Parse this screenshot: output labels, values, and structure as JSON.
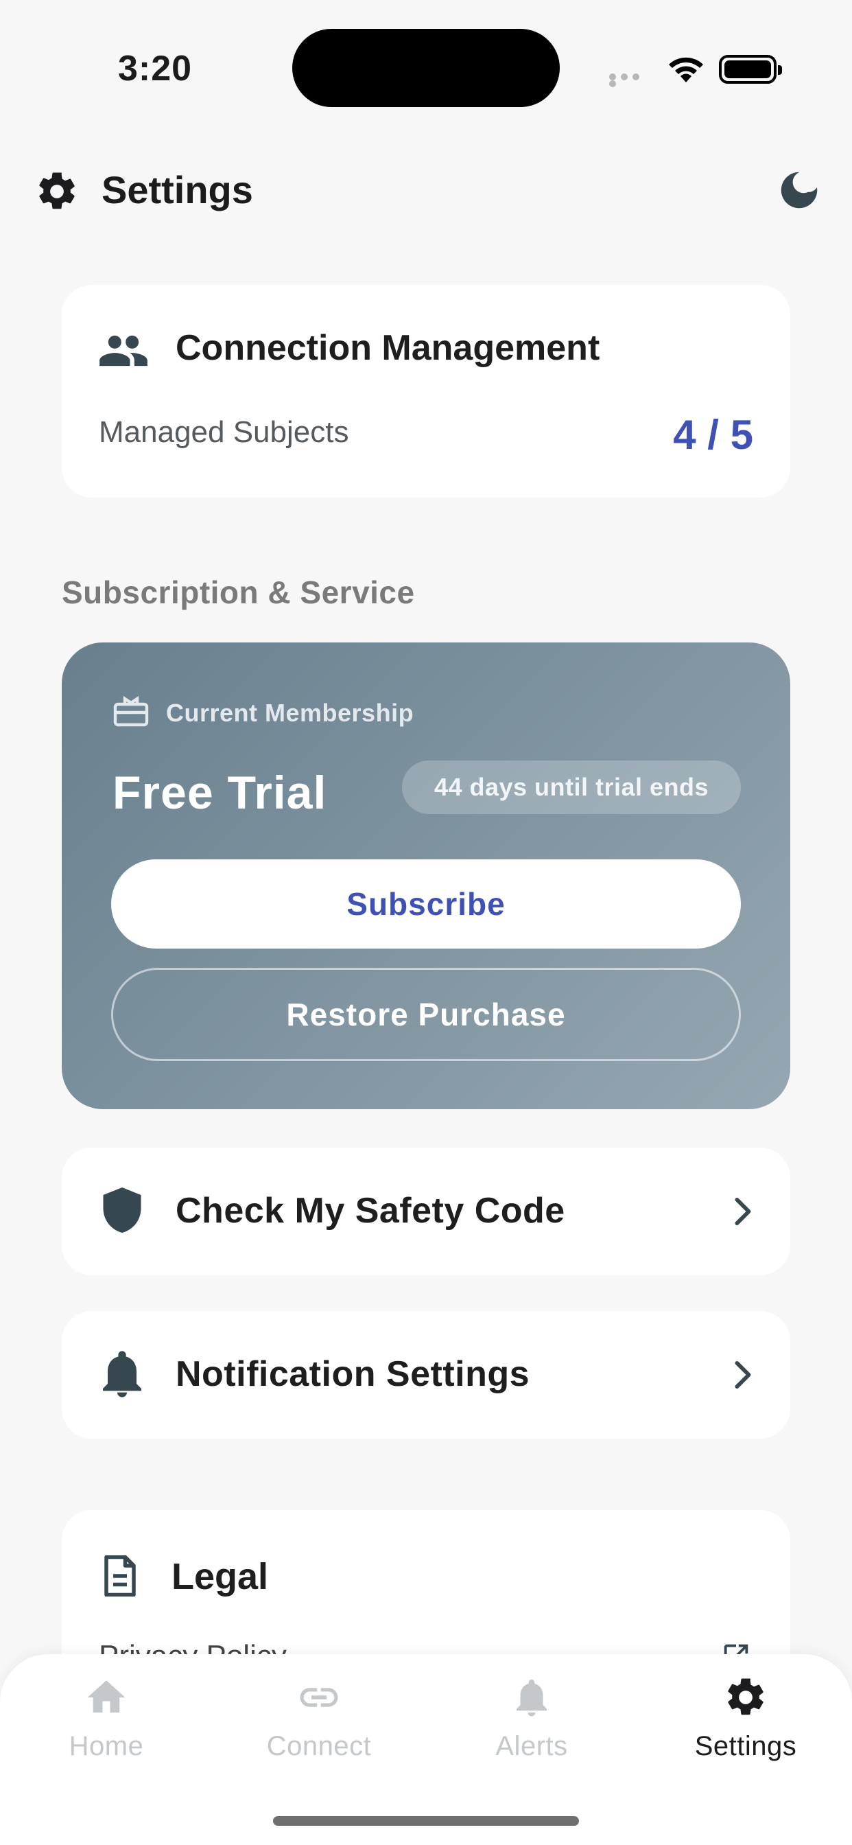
{
  "status_bar": {
    "time": "3:20"
  },
  "header": {
    "title": "Settings"
  },
  "connection": {
    "title": "Connection Management",
    "managed_label": "Managed Subjects",
    "managed_value": "4 / 5"
  },
  "subscription_section": {
    "label": "Subscription & Service"
  },
  "membership": {
    "label": "Current Membership",
    "plan": "Free Trial",
    "trial_badge": "44 days until trial ends",
    "subscribe_label": "Subscribe",
    "restore_label": "Restore Purchase"
  },
  "rows": {
    "safety_code": "Check My Safety Code",
    "notifications": "Notification Settings"
  },
  "legal": {
    "title": "Legal",
    "items": [
      "Privacy Policy"
    ]
  },
  "tabbar": {
    "tabs": [
      {
        "label": "Home",
        "icon": "home-icon",
        "active": false
      },
      {
        "label": "Connect",
        "icon": "link-icon",
        "active": false
      },
      {
        "label": "Alerts",
        "icon": "bell-icon",
        "active": false
      },
      {
        "label": "Settings",
        "icon": "gear-icon",
        "active": true
      }
    ]
  },
  "colors": {
    "accent": "#3f51b5",
    "icon_dark": "#37474f",
    "card_gradient_start": "#687f8e",
    "card_gradient_end": "#95a7b1",
    "tab_inactive": "#c4c8cb"
  }
}
